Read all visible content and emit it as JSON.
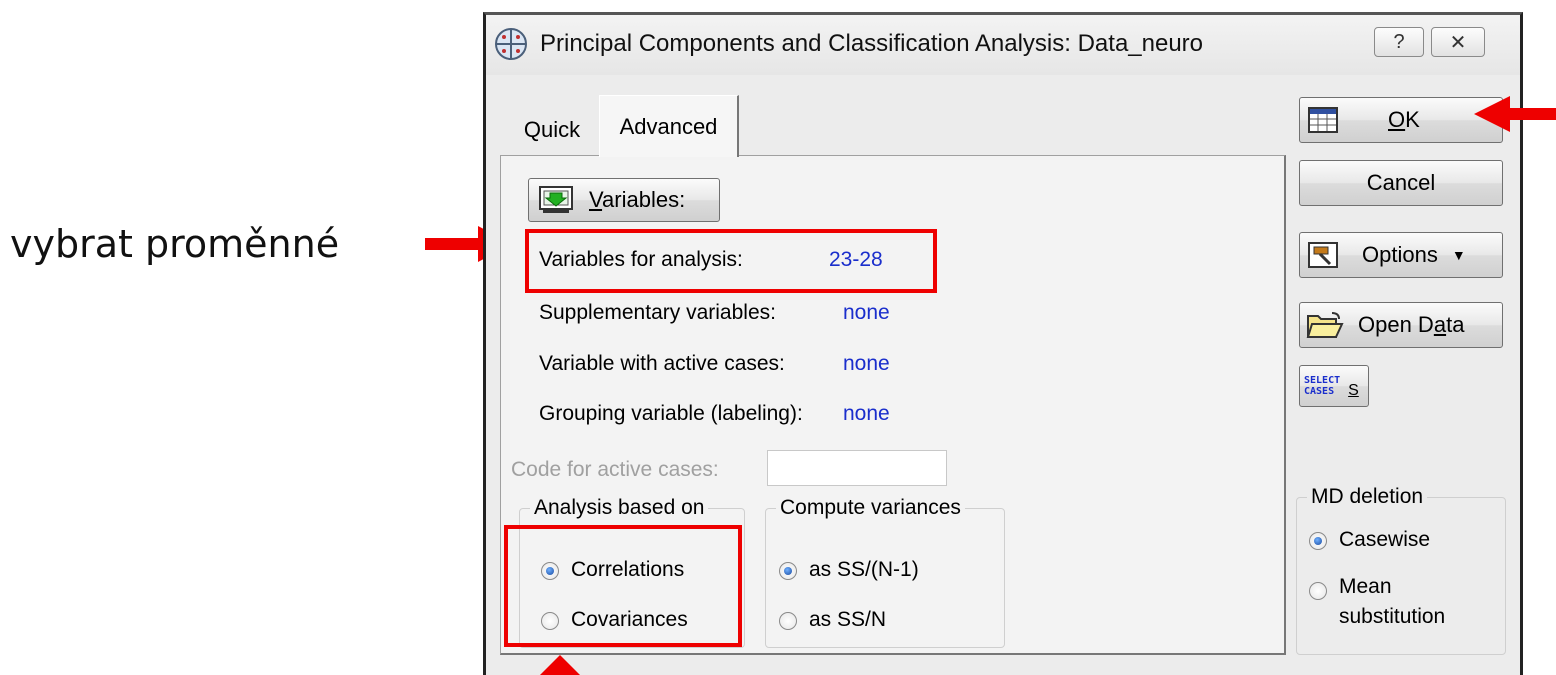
{
  "annotation": {
    "label": "vybrat proměnné"
  },
  "dialog": {
    "title": "Principal Components and Classification Analysis: Data_neuro",
    "help_button": "?",
    "close_button": "✕"
  },
  "tabs": [
    {
      "label": "Quick",
      "active": false
    },
    {
      "label": "Advanced",
      "active": true
    }
  ],
  "variables_button": {
    "label_pre": "",
    "label_u": "V",
    "label_post": "ariables:"
  },
  "fields": {
    "analysis_vars": {
      "label": "Variables for analysis:",
      "value": "23-28"
    },
    "supplementary_vars": {
      "label": "Supplementary variables:",
      "value": "none"
    },
    "active_cases_var": {
      "label": "Variable with active cases:",
      "value": "none"
    },
    "grouping_var": {
      "label": "Grouping variable (labeling):",
      "value": "none"
    },
    "code_active_cases": {
      "label": "Code for active cases:",
      "value": ""
    }
  },
  "analysis_based_on": {
    "legend": "Analysis based on",
    "options": [
      {
        "label": "Correlations",
        "selected": true
      },
      {
        "label": "Covariances",
        "selected": false
      }
    ]
  },
  "compute_variances": {
    "legend": "Compute variances",
    "options": [
      {
        "label": "as SS/(N-1)",
        "selected": true
      },
      {
        "label": "as SS/N",
        "selected": false
      }
    ]
  },
  "md_deletion": {
    "legend": "MD deletion",
    "options": [
      {
        "label": "Casewise",
        "selected": true
      },
      {
        "label": "Mean",
        "label2": "substitution",
        "selected": false
      }
    ]
  },
  "side_buttons": {
    "ok": {
      "u": "O",
      "rest": "K"
    },
    "cancel": "Cancel",
    "options": "Options",
    "open_data": {
      "pre": "Open D",
      "u": "a",
      "post": "ta"
    },
    "select_cases": {
      "icon_line1": "SELECT",
      "icon_line2": "CASES",
      "label": "S"
    }
  },
  "colors": {
    "accent_red": "#ee0000",
    "value_blue": "#1a2ecc"
  }
}
